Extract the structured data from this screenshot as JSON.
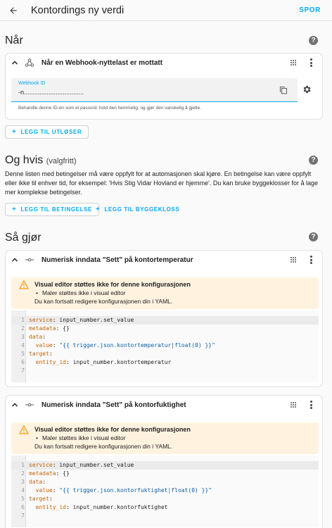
{
  "header": {
    "title": "Kontordings ny verdi",
    "action": "SPOR"
  },
  "when": {
    "heading": "Når",
    "trigger": {
      "title": "Når en Webhook-nyttelast er mottatt",
      "field_label": "Webhook ID",
      "field_value": "-n..................................",
      "helper": "Behandle denne ID-en som et passord: hold den hemmelig, og gjør den vanskelig å gjette."
    },
    "add_button": "LEGG TIL UTLØSER"
  },
  "conditions": {
    "heading": "Og hvis",
    "heading_suffix": "(valgfritt)",
    "description": "Denne listen med betingelser må være oppfylt for at automasjonen skal kjøre. En betingelse kan være oppfylt eller ikke til enhver tid, for eksempel: 'Hvis Stig Vidar Hovland er hjemme'. Du kan bruke byggeklosser for å lage mer komplekse betingelser.",
    "add_condition": "LEGG TIL BETINGELSE",
    "add_block": "LEGG TIL BYGGEKLOSS"
  },
  "actions": {
    "heading": "Så gjør",
    "items": [
      {
        "title": "Numerisk inndata \"Sett\" på kontortemperatur",
        "warn_title": "Visual editor støttes ikke for denne konfigurasjonen",
        "warn_item": "Maler støttes ikke i visual editor",
        "warn_text": "Du kan fortsatt redigere konfigurasjonen din i YAML.",
        "code": {
          "l1k": "service",
          "l1v": " input_number.set_value",
          "l2k": "metadata",
          "l2v": " {}",
          "l3k": "data",
          "l3v": "",
          "l4k": "  value",
          "l4v": " \"{{ trigger.json.kontortemperatur|float(0) }}\"",
          "l5k": "target",
          "l5v": "",
          "l6k": "  entity_id",
          "l6v": " input_number.kontortemperatur"
        }
      },
      {
        "title": "Numerisk inndata \"Sett\" på kontorfuktighet",
        "warn_title": "Visual editor støttes ikke for denne konfigurasjonen",
        "warn_item": "Maler støttes ikke i visual editor",
        "warn_text": "Du kan fortsatt redigere konfigurasjonen din i YAML.",
        "code": {
          "l1k": "service",
          "l1v": " input_number.set_value",
          "l2k": "metadata",
          "l2v": " {}",
          "l3k": "data",
          "l3v": "",
          "l4k": "  value",
          "l4v": " \"{{ trigger.json.kontorfuktighet|float(0) }}\"",
          "l5k": "target",
          "l5v": "",
          "l6k": "  entity_id",
          "l6v": " input_number.kontorfuktighet"
        }
      }
    ]
  },
  "line_numbers": [
    "1",
    "2",
    "3",
    "4",
    "5",
    "6",
    "7"
  ]
}
